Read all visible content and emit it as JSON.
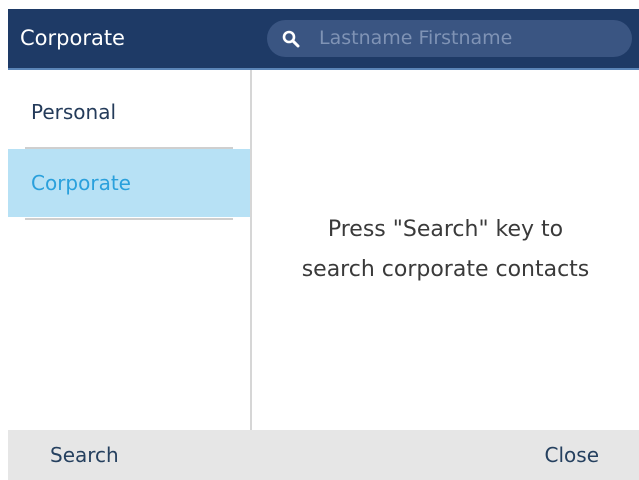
{
  "header": {
    "title": "Corporate",
    "search": {
      "placeholder": "Lastname Firstname",
      "icon": "search-icon"
    }
  },
  "sidebar": {
    "items": [
      {
        "label": "Personal",
        "selected": false
      },
      {
        "label": "Corporate",
        "selected": true
      }
    ]
  },
  "content": {
    "message_line1": "Press \"Search\" key to",
    "message_line2": "search corporate contacts"
  },
  "softkeys": {
    "left_label": "Search",
    "right_label": "Close"
  },
  "colors": {
    "header_bg": "#1e3a66",
    "search_bg": "#3a5582",
    "selected_bg": "#b7e1f5",
    "selected_text": "#2aa0dc",
    "softkey_bar_bg": "#e6e6e6"
  }
}
